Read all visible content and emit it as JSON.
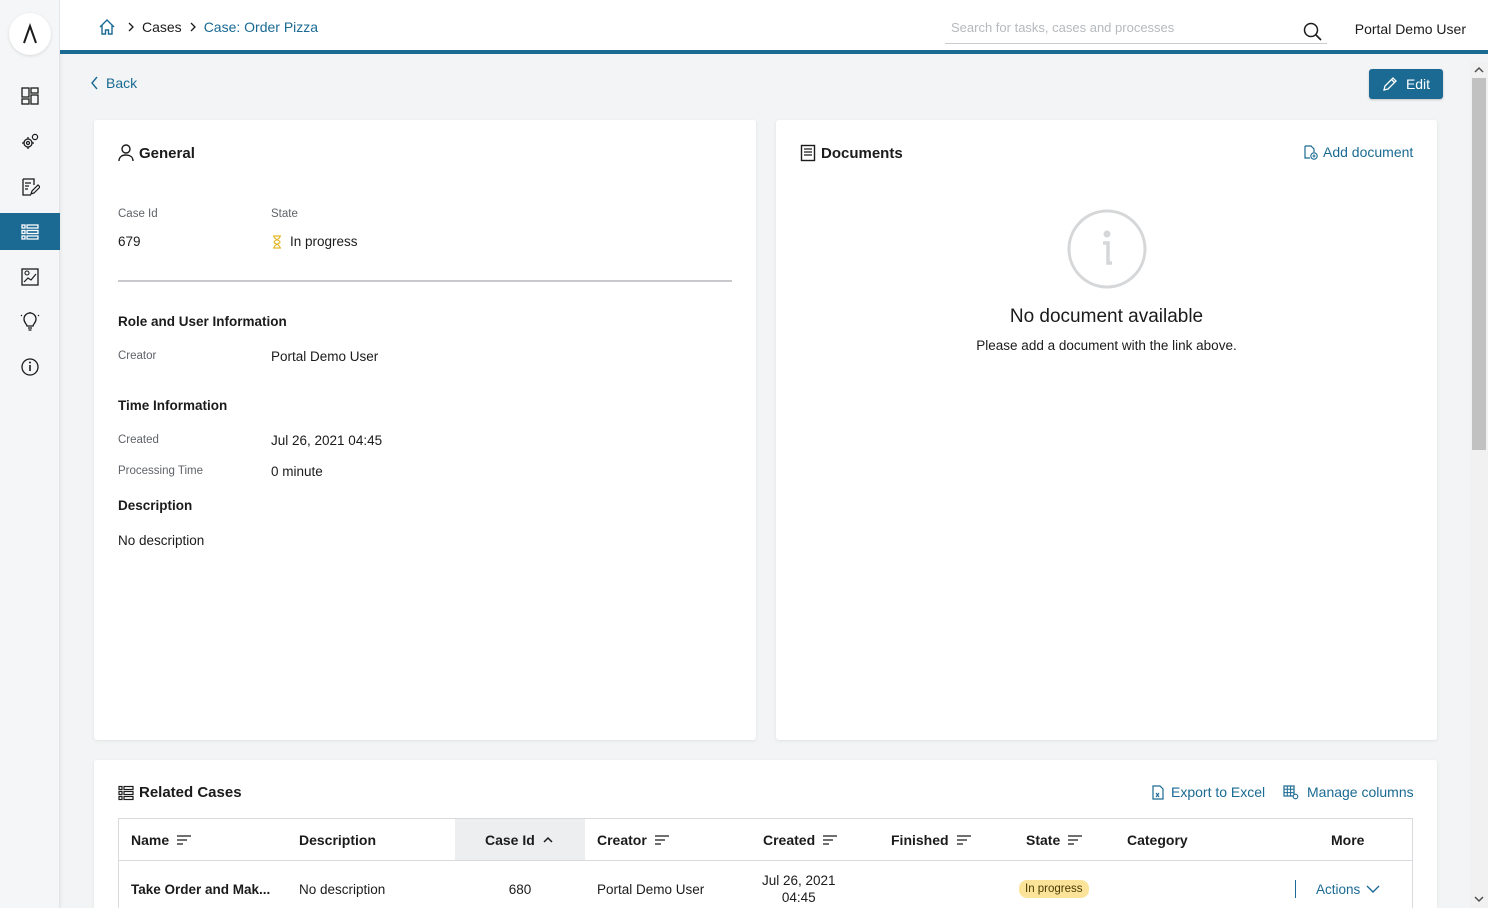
{
  "header": {
    "breadcrumb": [
      "Cases",
      "Case: Order Pizza"
    ],
    "search_placeholder": "Search for tasks, cases and processes",
    "user_name": "Portal Demo User"
  },
  "sidebar": {
    "items": [
      "dashboard-icon",
      "processes-icon",
      "tasks-icon",
      "cases-icon",
      "statistics-icon",
      "ideas-icon",
      "info-icon"
    ],
    "active_index": 3
  },
  "toolbar": {
    "back_label": "Back",
    "edit_label": "Edit"
  },
  "general": {
    "title": "General",
    "case_id_label": "Case Id",
    "case_id": "679",
    "state_label": "State",
    "state": "In progress",
    "role_section": "Role and User Information",
    "creator_label": "Creator",
    "creator": "Portal Demo User",
    "time_section": "Time Information",
    "created_label": "Created",
    "created": "Jul 26, 2021 04:45",
    "processing_label": "Processing Time",
    "processing": "0 minute",
    "description_section": "Description",
    "description": "No description"
  },
  "documents": {
    "title": "Documents",
    "add_label": "Add document",
    "empty_title": "No document available",
    "empty_sub": "Please add a document with the link above."
  },
  "related": {
    "title": "Related Cases",
    "export_label": "Export to Excel",
    "manage_label": "Manage columns",
    "columns": [
      "Name",
      "Description",
      "Case Id",
      "Creator",
      "Created",
      "Finished",
      "State",
      "Category",
      "More"
    ],
    "rows": [
      {
        "name": "Take Order and Mak...",
        "description": "No description",
        "case_id": "680",
        "creator": "Portal Demo User",
        "created_date": "Jul 26, 2021",
        "created_time": "04:45",
        "finished": "",
        "state": "In progress",
        "category": "",
        "actions": "Actions"
      }
    ]
  },
  "colors": {
    "primary": "#1a6a93",
    "badge": "#fbe49a",
    "state_icon": "#e5b829"
  }
}
